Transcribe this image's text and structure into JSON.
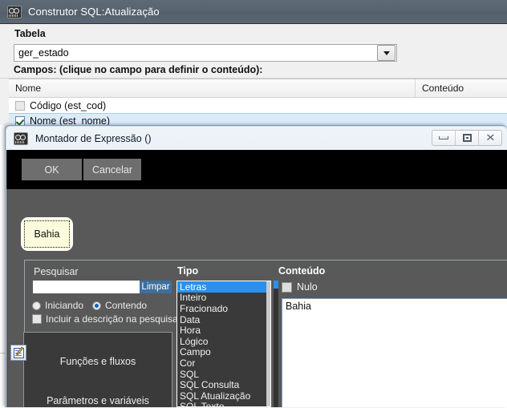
{
  "window_sql": {
    "title": "Construtor SQL:Atualização",
    "icon": "app-icon",
    "tabela_label": "Tabela",
    "tabela_value": "ger_estado",
    "campos_label": "Campos: (clique no campo para definir o conteúdo):",
    "grid": {
      "columns": [
        "Nome",
        "Conteúdo"
      ],
      "rows": [
        {
          "nome": "Código (est_cod)",
          "checked": false,
          "selected": false,
          "conteudo": ""
        },
        {
          "nome": "Nome (est_nome)",
          "checked": true,
          "selected": true,
          "conteudo": ""
        }
      ]
    }
  },
  "window_expr": {
    "title": "Montador de Expressão ()",
    "icon": "app-icon",
    "controls": {
      "minimize": "—",
      "maximize": "❐",
      "close": "✕"
    },
    "toolbar": {
      "ok_label": "OK",
      "cancel_label": "Cancelar"
    },
    "node": {
      "label": "Bahia"
    },
    "search": {
      "label": "Pesquisar",
      "value": "",
      "placeholder": "",
      "clear_label": "Limpar",
      "mode_options": [
        "Iniciando",
        "Contendo"
      ],
      "mode_selected": "Contendo",
      "include_description_label": "Incluir a descrição na pesquisa",
      "include_description_checked": false
    },
    "func_panel": {
      "items": [
        "Funções e fluxos",
        "Parâmetros e variáveis"
      ]
    },
    "edit_icon_button": "edit-icon",
    "tipo": {
      "label": "Tipo",
      "selected": "Letras",
      "items": [
        "Letras",
        "Inteiro",
        "Fracionado",
        "Data",
        "Hora",
        "Lógico",
        "Campo",
        "Cor",
        "SQL",
        "SQL Consulta",
        "SQL Atualização",
        "SQL Texto"
      ]
    },
    "conteudo": {
      "label": "Conteúdo",
      "nulo_label": "Nulo",
      "nulo_checked": false,
      "text_value": "Bahia"
    }
  },
  "colors": {
    "titlebar": "#58646f",
    "dark_surface": "#595959",
    "toolbar_black": "#000000",
    "accent_blue": "#2a90f0",
    "selection_row": "#dcebfa",
    "node_fill": "#fbfbdc",
    "limpar_blue": "#3e6f9e"
  }
}
